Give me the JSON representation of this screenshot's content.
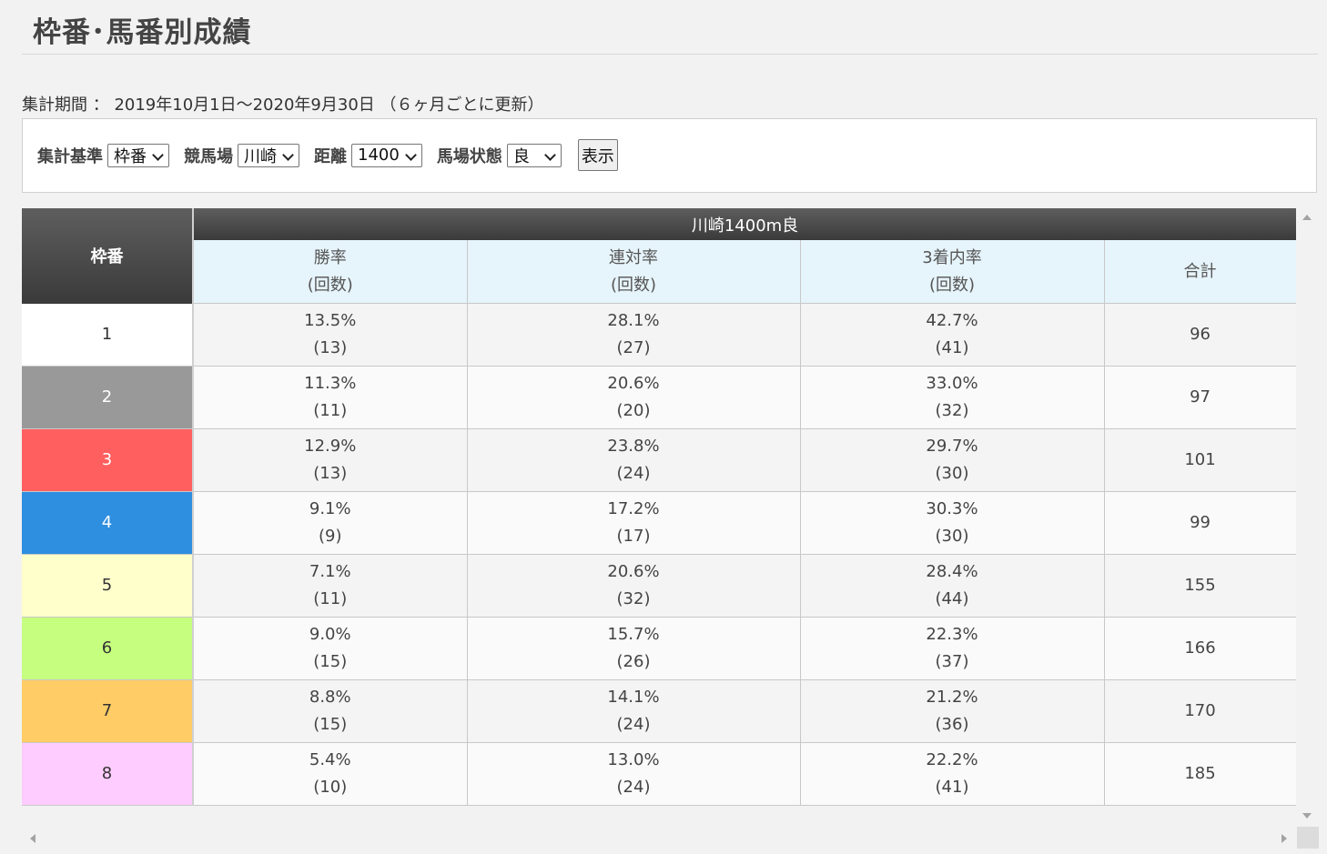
{
  "page": {
    "title": "枠番･馬番別成績",
    "period": "集計期間 ： 2019年10月1日～2020年9月30日 （６ヶ月ごとに更新）"
  },
  "filters": {
    "criteria_label": "集計基準",
    "criteria_value": "枠番",
    "course_label": "競馬場",
    "course_value": "川崎",
    "distance_label": "距離",
    "distance_value": "1400",
    "track_label": "馬場状態",
    "track_value": "良",
    "show_button": "表示"
  },
  "table": {
    "waku_header": "枠番",
    "course_header": "川崎1400m良",
    "columns": {
      "win": [
        "勝率",
        "(回数)"
      ],
      "place": [
        "連対率",
        "(回数)"
      ],
      "show": [
        "3着内率",
        "(回数)"
      ],
      "total": "合計"
    },
    "rows": [
      {
        "waku": "1",
        "bg": "#ffffff",
        "fg": "#333333",
        "win": "13.5%",
        "win_n": "(13)",
        "place": "28.1%",
        "place_n": "(27)",
        "show": "42.7%",
        "show_n": "(41)",
        "total": "96"
      },
      {
        "waku": "2",
        "bg": "#999999",
        "fg": "#ffffff",
        "win": "11.3%",
        "win_n": "(11)",
        "place": "20.6%",
        "place_n": "(20)",
        "show": "33.0%",
        "show_n": "(32)",
        "total": "97"
      },
      {
        "waku": "3",
        "bg": "#ff5f5f",
        "fg": "#ffffff",
        "win": "12.9%",
        "win_n": "(13)",
        "place": "23.8%",
        "place_n": "(24)",
        "show": "29.7%",
        "show_n": "(30)",
        "total": "101"
      },
      {
        "waku": "4",
        "bg": "#2e8ee0",
        "fg": "#ffffff",
        "win": "9.1%",
        "win_n": "(9)",
        "place": "17.2%",
        "place_n": "(17)",
        "show": "30.3%",
        "show_n": "(30)",
        "total": "99"
      },
      {
        "waku": "5",
        "bg": "#ffffcc",
        "fg": "#333333",
        "win": "7.1%",
        "win_n": "(11)",
        "place": "20.6%",
        "place_n": "(32)",
        "show": "28.4%",
        "show_n": "(44)",
        "total": "155"
      },
      {
        "waku": "6",
        "bg": "#c6ff80",
        "fg": "#333333",
        "win": "9.0%",
        "win_n": "(15)",
        "place": "15.7%",
        "place_n": "(26)",
        "show": "22.3%",
        "show_n": "(37)",
        "total": "166"
      },
      {
        "waku": "7",
        "bg": "#ffcc66",
        "fg": "#333333",
        "win": "8.8%",
        "win_n": "(15)",
        "place": "14.1%",
        "place_n": "(24)",
        "show": "21.2%",
        "show_n": "(36)",
        "total": "170"
      },
      {
        "waku": "8",
        "bg": "#ffccff",
        "fg": "#333333",
        "win": "5.4%",
        "win_n": "(10)",
        "place": "13.0%",
        "place_n": "(24)",
        "show": "22.2%",
        "show_n": "(41)",
        "total": "185"
      }
    ]
  }
}
